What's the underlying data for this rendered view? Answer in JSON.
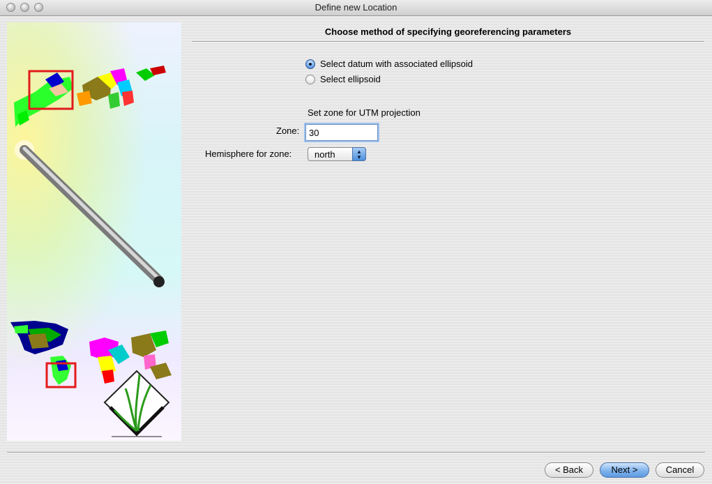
{
  "window": {
    "title": "Define new Location"
  },
  "header": {
    "title": "Choose method of specifying georeferencing parameters"
  },
  "options": [
    {
      "label": "Select datum with associated ellipsoid",
      "selected": true
    },
    {
      "label": "Select ellipsoid",
      "selected": false
    }
  ],
  "utm": {
    "section_label": "Set zone for UTM projection",
    "zone_label": "Zone:",
    "zone_value": "30",
    "hemisphere_label": "Hemisphere for zone:",
    "hemisphere_value": "north"
  },
  "buttons": {
    "back": "< Back",
    "next": "Next >",
    "cancel": "Cancel"
  },
  "icons": {
    "sidebar": "grass-gis-map-illustration",
    "select_arrows": "updown-arrows-icon"
  }
}
